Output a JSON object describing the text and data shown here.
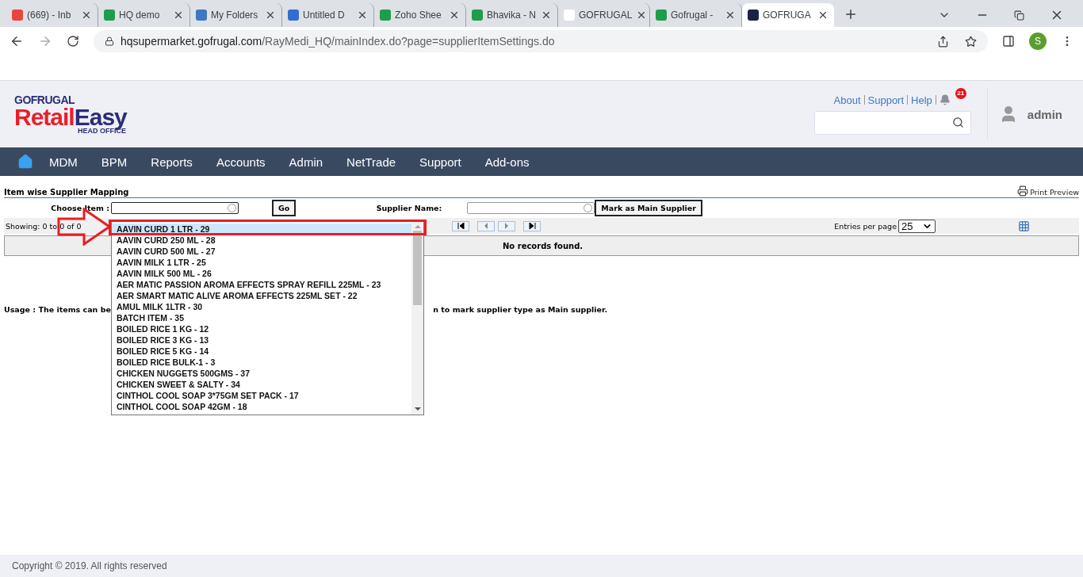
{
  "browser": {
    "tabs": [
      {
        "title": "(669) - Inb",
        "selected": false
      },
      {
        "title": "HQ demo",
        "selected": false
      },
      {
        "title": "My Folders",
        "selected": false
      },
      {
        "title": "Untitled D",
        "selected": false
      },
      {
        "title": "Zoho Shee",
        "selected": false
      },
      {
        "title": "Bhavika - N",
        "selected": false
      },
      {
        "title": "GOFRUGAL",
        "selected": false
      },
      {
        "title": "Gofrugal -",
        "selected": false
      },
      {
        "title": "GOFRUGA",
        "selected": true
      }
    ],
    "url_host": "hqsupermarket.gofrugal.com",
    "url_path": "/RayMedi_HQ/mainIndex.do?page=supplierItemSettings.do",
    "profile": "S"
  },
  "header": {
    "logo": {
      "brand": "GOFRUGAL",
      "word_a": "Retail",
      "word_b": "Easy",
      "sub": "HEAD OFFICE"
    },
    "links": [
      "About",
      "Support",
      "Help"
    ],
    "notifications": "21",
    "user": "admin"
  },
  "nav": [
    "MDM",
    "BPM",
    "Reports",
    "Accounts",
    "Admin",
    "NetTrade",
    "Support",
    "Add-ons"
  ],
  "page": {
    "title": "Item wise Supplier Mapping",
    "print": "Print Preview",
    "choose_label": "Choose Item :",
    "go": "Go",
    "supplier_label": "Supplier Name:",
    "mark_button": "Mark as Main Supplier",
    "showing": "Showing: 0 to 0 of 0",
    "entries_label": "Entries per page",
    "entries_value": "25",
    "empty": "No records found.",
    "usage_start": "Usage : The items can be",
    "usage_end": "n to mark supplier type as Main supplier."
  },
  "dropdown": [
    {
      "label": "AAVIN CURD 1 LTR - 29",
      "selected": true
    },
    {
      "label": "AAVIN CURD 250 ML - 28",
      "selected": false
    },
    {
      "label": "AAVIN CURD 500 ML - 27",
      "selected": false
    },
    {
      "label": "AAVIN MILK 1 LTR - 25",
      "selected": false
    },
    {
      "label": "AAVIN MILK 500 ML - 26",
      "selected": false
    },
    {
      "label": "AER MATIC PASSION AROMA EFFECTS SPRAY REFILL 225ML - 23",
      "selected": false
    },
    {
      "label": "AER SMART MATIC ALIVE AROMA EFFECTS 225ML SET - 22",
      "selected": false
    },
    {
      "label": "AMUL MILK 1LTR - 30",
      "selected": false
    },
    {
      "label": "BATCH ITEM - 35",
      "selected": false
    },
    {
      "label": "BOILED RICE 1 KG - 12",
      "selected": false
    },
    {
      "label": "BOILED RICE 3 KG - 13",
      "selected": false
    },
    {
      "label": "BOILED RICE 5 KG - 14",
      "selected": false
    },
    {
      "label": "BOILED RICE BULK-1 - 3",
      "selected": false
    },
    {
      "label": "CHICKEN NUGGETS 500GMS - 37",
      "selected": false
    },
    {
      "label": "CHICKEN SWEET & SALTY - 34",
      "selected": false
    },
    {
      "label": "CINTHOL COOL SOAP 3*75GM SET PACK - 17",
      "selected": false
    },
    {
      "label": "CINTHOL COOL SOAP 42GM - 18",
      "selected": false
    }
  ],
  "footer": "Copyright © 2019. All rights reserved"
}
